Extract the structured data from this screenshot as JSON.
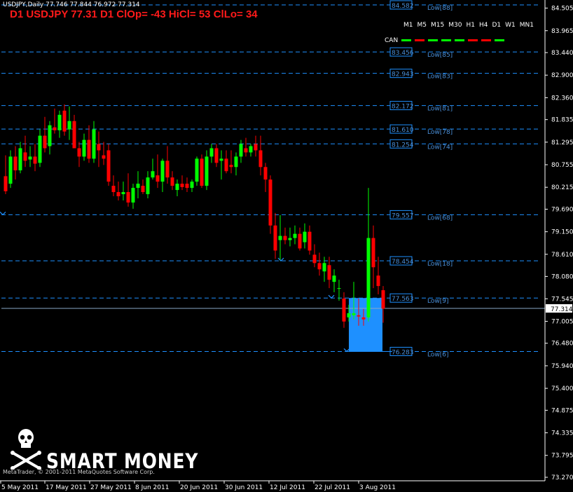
{
  "window": {
    "symbol_info": "USDJPY,Daily  77.746 77.844 76.972 77.314",
    "headline": "D1 USDJPY 77.31 D1 ClOp= -43 HiCl= 53 ClLo= 34"
  },
  "timeframes": [
    "M1",
    "M5",
    "M15",
    "M30",
    "H1",
    "H4",
    "D1",
    "W1",
    "MN1"
  ],
  "can": {
    "label": "CAN",
    "dash_colors": [
      "#00ff00",
      "#ff0000",
      "#00ff00",
      "#00ff00",
      "#00ff00",
      "#ff0000",
      "#ff0000",
      "#00ff00"
    ]
  },
  "colors": {
    "background": "#000000",
    "bull": "#00ff00",
    "bear": "#ff0000",
    "level_line": "#1e90ff",
    "level_text": "#4a8fd8",
    "zone": "#1e90ff",
    "axis_text": "#ffffff"
  },
  "current_price": "77.314",
  "price_axis": [
    "84.505",
    "83.965",
    "83.440",
    "82.900",
    "82.360",
    "81.835",
    "81.295",
    "80.755",
    "80.215",
    "79.690",
    "79.150",
    "78.610",
    "78.080",
    "77.545",
    "77.005",
    "76.480",
    "75.940",
    "75.400",
    "74.875",
    "74.335",
    "73.795",
    "73.270"
  ],
  "date_axis": [
    "5 May 2011",
    "17 May 2011",
    "27 May 2011",
    "8 Jun 2011",
    "20 Jun 2011",
    "30 Jun 2011",
    "12 Jul 2011",
    "22 Jul 2011",
    "3 Aug 2011"
  ],
  "levels": [
    {
      "price": "84.582",
      "label": "Low[88]"
    },
    {
      "price": "83.456",
      "label": "Low[85]"
    },
    {
      "price": "82.943",
      "label": "Low[83]"
    },
    {
      "price": "82.172",
      "label": "Low[81]"
    },
    {
      "price": "81.610",
      "label": "Low[78]"
    },
    {
      "price": "81.254",
      "label": "Low[74]"
    },
    {
      "price": "79.557",
      "label": "Low[68]"
    },
    {
      "price": "78.454",
      "label": "Low[18]"
    },
    {
      "price": "77.563",
      "label": "Low[9]"
    },
    {
      "price": "76.283",
      "label": "Low[6]"
    }
  ],
  "zone": {
    "top": 77.563,
    "bottom": 76.283
  },
  "chart_data": {
    "type": "candlestick",
    "symbol": "USDJPY",
    "timeframe": "Daily",
    "ylim": [
      73.0,
      84.7
    ],
    "candles": [
      {
        "o": 80.48,
        "h": 80.98,
        "l": 80.05,
        "c": 80.12
      },
      {
        "o": 80.3,
        "h": 81.1,
        "l": 80.2,
        "c": 80.95
      },
      {
        "o": 80.95,
        "h": 81.2,
        "l": 80.4,
        "c": 80.62
      },
      {
        "o": 80.62,
        "h": 81.3,
        "l": 80.55,
        "c": 81.15
      },
      {
        "o": 81.05,
        "h": 81.45,
        "l": 80.7,
        "c": 80.85
      },
      {
        "o": 80.88,
        "h": 81.2,
        "l": 80.7,
        "c": 80.95
      },
      {
        "o": 80.95,
        "h": 81.25,
        "l": 80.6,
        "c": 80.78
      },
      {
        "o": 80.8,
        "h": 81.6,
        "l": 80.7,
        "c": 81.45
      },
      {
        "o": 81.45,
        "h": 81.9,
        "l": 81.05,
        "c": 81.15
      },
      {
        "o": 81.2,
        "h": 81.8,
        "l": 81.0,
        "c": 81.7
      },
      {
        "o": 81.65,
        "h": 82.1,
        "l": 81.5,
        "c": 81.58
      },
      {
        "o": 81.58,
        "h": 82.05,
        "l": 81.4,
        "c": 81.95
      },
      {
        "o": 82.05,
        "h": 82.2,
        "l": 81.45,
        "c": 81.55
      },
      {
        "o": 81.6,
        "h": 82.15,
        "l": 81.35,
        "c": 81.8
      },
      {
        "o": 81.8,
        "h": 81.95,
        "l": 81.2,
        "c": 81.15
      },
      {
        "o": 81.15,
        "h": 81.3,
        "l": 80.7,
        "c": 80.95
      },
      {
        "o": 80.95,
        "h": 81.5,
        "l": 80.85,
        "c": 81.35
      },
      {
        "o": 81.35,
        "h": 81.7,
        "l": 80.8,
        "c": 80.9
      },
      {
        "o": 80.9,
        "h": 81.8,
        "l": 80.8,
        "c": 81.6
      },
      {
        "o": 81.25,
        "h": 81.55,
        "l": 80.7,
        "c": 81.1
      },
      {
        "o": 80.98,
        "h": 81.3,
        "l": 80.75,
        "c": 80.9
      },
      {
        "o": 81.1,
        "h": 81.25,
        "l": 80.25,
        "c": 80.35
      },
      {
        "o": 80.25,
        "h": 80.5,
        "l": 80.0,
        "c": 80.1
      },
      {
        "o": 80.1,
        "h": 80.35,
        "l": 79.9,
        "c": 80.0
      },
      {
        "o": 80.05,
        "h": 80.35,
        "l": 79.9,
        "c": 80.1
      },
      {
        "o": 80.1,
        "h": 80.55,
        "l": 79.75,
        "c": 79.85
      },
      {
        "o": 79.85,
        "h": 80.3,
        "l": 79.7,
        "c": 80.2
      },
      {
        "o": 80.2,
        "h": 80.6,
        "l": 79.95,
        "c": 80.3
      },
      {
        "o": 80.25,
        "h": 80.4,
        "l": 80.05,
        "c": 80.1
      },
      {
        "o": 80.05,
        "h": 80.6,
        "l": 79.95,
        "c": 80.45
      },
      {
        "o": 80.45,
        "h": 80.9,
        "l": 80.4,
        "c": 80.6
      },
      {
        "o": 80.5,
        "h": 81.0,
        "l": 80.2,
        "c": 80.35
      },
      {
        "o": 80.35,
        "h": 80.9,
        "l": 80.1,
        "c": 80.85
      },
      {
        "o": 80.85,
        "h": 81.2,
        "l": 80.3,
        "c": 80.45
      },
      {
        "o": 80.45,
        "h": 80.6,
        "l": 80.15,
        "c": 80.25
      },
      {
        "o": 80.15,
        "h": 80.4,
        "l": 80.0,
        "c": 80.3
      },
      {
        "o": 80.3,
        "h": 80.5,
        "l": 80.15,
        "c": 80.22
      },
      {
        "o": 80.3,
        "h": 80.45,
        "l": 80.1,
        "c": 80.2
      },
      {
        "o": 80.2,
        "h": 80.4,
        "l": 80.1,
        "c": 80.35
      },
      {
        "o": 80.35,
        "h": 80.95,
        "l": 80.25,
        "c": 80.9
      },
      {
        "o": 80.9,
        "h": 81.0,
        "l": 80.2,
        "c": 80.25
      },
      {
        "o": 80.25,
        "h": 81.1,
        "l": 80.15,
        "c": 80.95
      },
      {
        "o": 80.95,
        "h": 81.25,
        "l": 80.8,
        "c": 81.15
      },
      {
        "o": 81.15,
        "h": 81.25,
        "l": 80.7,
        "c": 80.8
      },
      {
        "o": 80.85,
        "h": 81.1,
        "l": 80.4,
        "c": 80.9
      },
      {
        "o": 80.9,
        "h": 81.1,
        "l": 80.55,
        "c": 80.6
      },
      {
        "o": 80.75,
        "h": 81.1,
        "l": 80.55,
        "c": 80.7
      },
      {
        "o": 80.7,
        "h": 81.05,
        "l": 80.5,
        "c": 80.95
      },
      {
        "o": 80.95,
        "h": 81.35,
        "l": 80.8,
        "c": 81.25
      },
      {
        "o": 81.15,
        "h": 81.4,
        "l": 80.95,
        "c": 81.05
      },
      {
        "o": 81.05,
        "h": 81.25,
        "l": 80.95,
        "c": 81.2
      },
      {
        "o": 81.25,
        "h": 81.45,
        "l": 80.95,
        "c": 81.1
      },
      {
        "o": 81.1,
        "h": 81.45,
        "l": 80.5,
        "c": 80.7
      },
      {
        "o": 80.7,
        "h": 80.8,
        "l": 80.1,
        "c": 80.4
      },
      {
        "o": 80.4,
        "h": 80.5,
        "l": 79.1,
        "c": 79.3
      },
      {
        "o": 79.3,
        "h": 79.6,
        "l": 78.5,
        "c": 78.7
      },
      {
        "o": 78.95,
        "h": 79.55,
        "l": 78.45,
        "c": 79.05
      },
      {
        "o": 79.05,
        "h": 79.25,
        "l": 78.85,
        "c": 78.95
      },
      {
        "o": 78.95,
        "h": 79.25,
        "l": 78.8,
        "c": 79.0
      },
      {
        "o": 79.0,
        "h": 79.3,
        "l": 78.85,
        "c": 79.1
      },
      {
        "o": 79.1,
        "h": 79.25,
        "l": 78.7,
        "c": 78.75
      },
      {
        "o": 78.9,
        "h": 79.35,
        "l": 78.75,
        "c": 79.15
      },
      {
        "o": 79.15,
        "h": 79.3,
        "l": 78.6,
        "c": 78.7
      },
      {
        "o": 78.6,
        "h": 78.85,
        "l": 78.3,
        "c": 78.4
      },
      {
        "o": 78.4,
        "h": 78.65,
        "l": 78.1,
        "c": 78.25
      },
      {
        "o": 78.2,
        "h": 78.55,
        "l": 77.95,
        "c": 78.4
      },
      {
        "o": 78.35,
        "h": 78.55,
        "l": 77.8,
        "c": 78.0
      },
      {
        "o": 77.95,
        "h": 78.25,
        "l": 77.7,
        "c": 78.1
      },
      {
        "o": 77.8,
        "h": 78.0,
        "l": 77.5,
        "c": 77.8
      },
      {
        "o": 77.55,
        "h": 77.7,
        "l": 76.85,
        "c": 77.0
      },
      {
        "o": 77.1,
        "h": 77.4,
        "l": 77.0,
        "c": 77.2
      },
      {
        "o": 77.15,
        "h": 77.95,
        "l": 77.05,
        "c": 77.2
      },
      {
        "o": 77.15,
        "h": 77.55,
        "l": 76.9,
        "c": 77.12
      },
      {
        "o": 77.1,
        "h": 77.3,
        "l": 76.9,
        "c": 77.05
      },
      {
        "o": 77.1,
        "h": 80.2,
        "l": 77.0,
        "c": 79.0
      },
      {
        "o": 79.0,
        "h": 79.3,
        "l": 77.8,
        "c": 78.3
      },
      {
        "o": 78.1,
        "h": 78.55,
        "l": 77.65,
        "c": 77.85
      },
      {
        "o": 77.75,
        "h": 77.85,
        "l": 76.97,
        "c": 77.31
      }
    ]
  }
}
